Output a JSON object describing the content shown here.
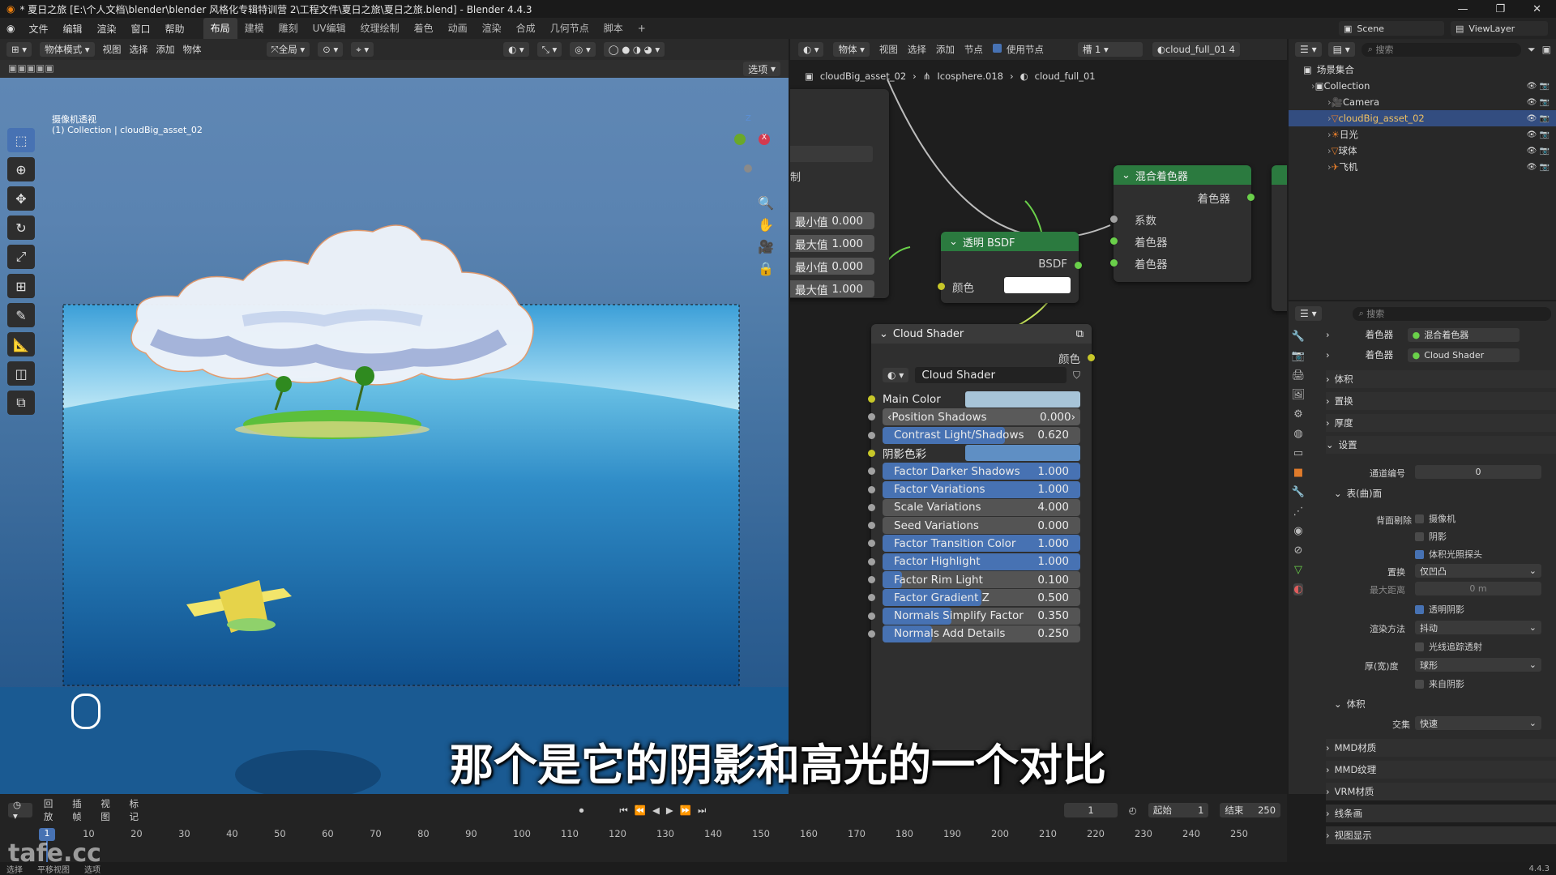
{
  "window": {
    "title": "* 夏日之旅 [E:\\个人文档\\blender\\blender 风格化专辑特训营 2\\工程文件\\夏日之旅\\夏日之旅.blend] - Blender 4.4.3",
    "controls": [
      "—",
      "❐",
      "✕"
    ]
  },
  "menu": [
    "文件",
    "编辑",
    "渲染",
    "窗口",
    "帮助"
  ],
  "workspaces": [
    "布局",
    "建模",
    "雕刻",
    "UV编辑",
    "纹理绘制",
    "着色",
    "动画",
    "渲染",
    "合成",
    "几何节点",
    "脚本",
    "+"
  ],
  "scene": {
    "label": "Scene",
    "viewlayer": "ViewLayer"
  },
  "viewport": {
    "header": {
      "mode": "物体模式",
      "items": [
        "视图",
        "选择",
        "添加",
        "物体"
      ],
      "transform": "全局",
      "options": "选项"
    },
    "overlay": {
      "camera_label": "摄像机透视",
      "collection_label": "(1) Collection | cloudBig_asset_02"
    },
    "gizmo": {
      "z": "Z",
      "y": "Y",
      "x": "X"
    }
  },
  "node_editor": {
    "header": {
      "type": "物体",
      "items": [
        "视图",
        "选择",
        "添加",
        "节点"
      ],
      "use_nodes": "使用节点",
      "slot": "槽 1",
      "material": "cloud_full_01",
      "users": "4"
    },
    "breadcrumb": [
      "cloudBig_asset_02",
      "Icosphere.018",
      "cloud_full_01"
    ],
    "left_node": {
      "fields": [
        {
          "label": "最小值",
          "value": "0.000"
        },
        {
          "label": "最大值",
          "value": "1.000"
        },
        {
          "label": "最小值",
          "value": "0.000"
        },
        {
          "label": "最大值",
          "value": "1.000"
        }
      ],
      "frag": "制"
    },
    "mix_node": {
      "title": "混合着色器",
      "out": "着色器",
      "inputs": [
        "系数",
        "着色器",
        "着色器"
      ]
    },
    "transparent_node": {
      "title": "透明 BSDF",
      "out": "BSDF",
      "color_label": "颜色"
    },
    "cloud_node": {
      "title": "Cloud Shader",
      "out": "颜色",
      "group": "Cloud Shader",
      "fields": [
        {
          "label": "Main Color",
          "value": "",
          "kind": "color"
        },
        {
          "label": "Position Shadows",
          "value": "0.000",
          "fill": 0.0,
          "kind": "arrow"
        },
        {
          "label": "Contrast Light/Shadows",
          "value": "0.620",
          "fill": 0.62
        },
        {
          "label": "阴影色彩",
          "value": "",
          "kind": "color2"
        },
        {
          "label": "Factor Darker Shadows",
          "value": "1.000",
          "fill": 1.0
        },
        {
          "label": "Factor Variations",
          "value": "1.000",
          "fill": 1.0
        },
        {
          "label": "Scale Variations",
          "value": "4.000",
          "fill": 0.0
        },
        {
          "label": "Seed Variations",
          "value": "0.000",
          "fill": 0.0
        },
        {
          "label": "Factor Transition Color",
          "value": "1.000",
          "fill": 1.0
        },
        {
          "label": "Factor Highlight",
          "value": "1.000",
          "fill": 1.0
        },
        {
          "label": "Factor Rim Light",
          "value": "0.100",
          "fill": 0.1
        },
        {
          "label": "Factor Gradient Z",
          "value": "0.500",
          "fill": 0.5
        },
        {
          "label": "Normals Simplify Factor",
          "value": "0.350",
          "fill": 0.35
        },
        {
          "label": "Normals Add Details",
          "value": "0.250",
          "fill": 0.25
        }
      ]
    }
  },
  "outliner": {
    "search_placeholder": "搜索",
    "root": "场景集合",
    "items": [
      {
        "label": "Collection",
        "depth": 1
      },
      {
        "label": "Camera",
        "depth": 2
      },
      {
        "label": "cloudBig_asset_02",
        "depth": 2,
        "selected": true
      },
      {
        "label": "日光",
        "depth": 2
      },
      {
        "label": "球体",
        "depth": 2
      },
      {
        "label": "飞机",
        "depth": 2
      }
    ],
    "badge_sphere": "2",
    "badge_plane": "0"
  },
  "properties": {
    "search_placeholder": "搜索",
    "shader_rows": [
      {
        "label": "着色器",
        "value": "混合着色器"
      },
      {
        "label": "着色器",
        "value": "Cloud Shader"
      }
    ],
    "sections": [
      "体积",
      "置换",
      "厚度",
      "设置"
    ],
    "settings": {
      "pass_index_label": "通道编号",
      "pass_index": "0",
      "surface": "表(曲)面",
      "backface": "背面剔除",
      "cam": "摄像机",
      "shadow": "阴影",
      "volume_probe": "体积光照探头",
      "displace_label": "置换",
      "displace_val": "仅凹凸",
      "maxdist_label": "最大距离",
      "maxdist_val": "0 m",
      "transparent_shadow": "透明阴影",
      "render_method_label": "渲染方法",
      "render_method_val": "抖动",
      "raytrace": "光线追踪透射",
      "thickness_label": "厚(宽)度",
      "thickness_val": "球形",
      "from_shadow": "来自阴影",
      "volume": "体积",
      "intersection_label": "交集",
      "intersection_val": "快速"
    },
    "bottom_sections": [
      "MMD材质",
      "MMD纹理",
      "VRM材质",
      "线条画",
      "视图显示"
    ]
  },
  "timeline": {
    "menu": [
      "回放",
      "插帧",
      "视图",
      "标记"
    ],
    "current": "1",
    "start_label": "起始",
    "start": "1",
    "end_label": "结束",
    "end": "250",
    "ticks": [
      "1",
      "10",
      "20",
      "30",
      "40",
      "50",
      "60",
      "70",
      "80",
      "90",
      "100",
      "110",
      "120",
      "130",
      "140",
      "150",
      "160",
      "170",
      "180",
      "190",
      "200",
      "210",
      "220",
      "230",
      "240",
      "250"
    ]
  },
  "status": {
    "items": [
      "选择",
      "平移视图",
      "选项"
    ],
    "version": "4.4.3"
  },
  "watermark": "tafe.cc",
  "subtitle": "那个是它的阴影和高光的一个对比"
}
